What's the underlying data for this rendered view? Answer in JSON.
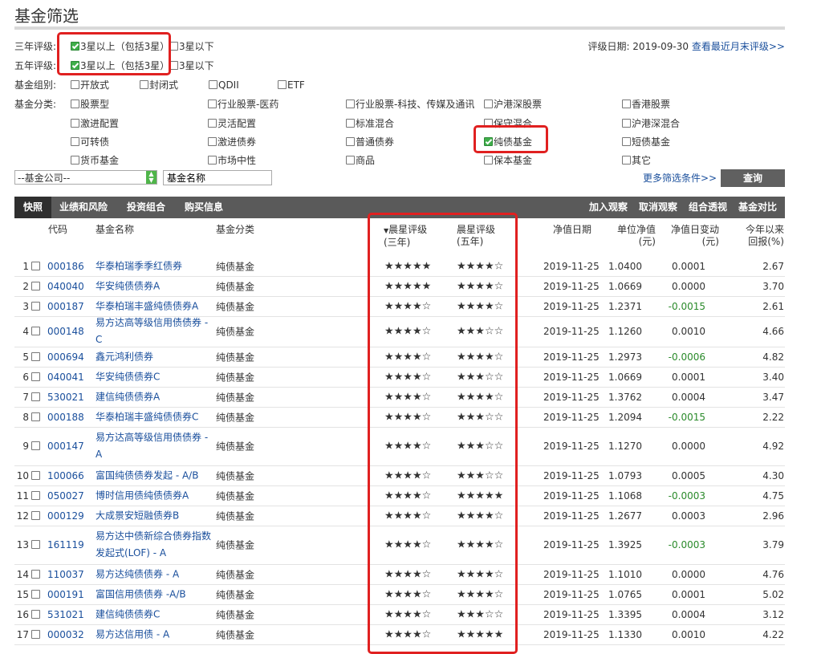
{
  "page_title": "基金筛选",
  "filters": {
    "three_year": {
      "label": "三年评级:",
      "opt1": "3星以上（包括3星）",
      "opt1_checked": true,
      "opt2": "3星以下"
    },
    "five_year": {
      "label": "五年评级:",
      "opt1": "3星以上（包括3星）",
      "opt1_checked": true,
      "opt2": "3星以下"
    },
    "rating_date_label": "评级日期: 2019-09-30",
    "rating_date_link": "查看最近月末评级>>",
    "group": {
      "label": "基金组别:",
      "options": [
        "开放式",
        "封闭式",
        "QDII",
        "ETF"
      ]
    },
    "category": {
      "label": "基金分类:",
      "options": [
        [
          "股票型",
          "行业股票-医药",
          "行业股票-科技、传媒及通讯",
          "沪港深股票",
          "香港股票"
        ],
        [
          "激进配置",
          "灵活配置",
          "标准混合",
          "保守混合",
          "沪港深混合"
        ],
        [
          "可转债",
          "激进债券",
          "普通债券",
          "纯债基金",
          "短债基金"
        ],
        [
          "货币基金",
          "市场中性",
          "商品",
          "保本基金",
          "其它"
        ]
      ],
      "checked": "纯债基金"
    },
    "company_select": "--基金公司--",
    "name_input": "基金名称",
    "more_link": "更多筛选条件>>",
    "search_button": "查询"
  },
  "tabs": [
    "快照",
    "业绩和风险",
    "投资组合",
    "购买信息"
  ],
  "actions": [
    "加入观察",
    "取消观察",
    "组合透视",
    "基金对比"
  ],
  "columns": {
    "code": "代码",
    "name": "基金名称",
    "category": "基金分类",
    "star3": [
      "晨星评级",
      "(三年)"
    ],
    "star5": [
      "晨星评级",
      "(五年)"
    ],
    "date": "净值日期",
    "nav": [
      "单位净值",
      "(元)"
    ],
    "chg": [
      "净值日变动",
      "(元)"
    ],
    "ret": [
      "今年以来",
      "回报(%)"
    ]
  },
  "rows": [
    {
      "idx": "1",
      "code": "000186",
      "name": "华泰柏瑞季季红债券",
      "cat": "纯债基金",
      "s3": 5,
      "s5": 4,
      "date": "2019-11-25",
      "nav": "1.0400",
      "chg": "0.0001",
      "ret": "2.67"
    },
    {
      "idx": "2",
      "code": "040040",
      "name": "华安纯债债券A",
      "cat": "纯债基金",
      "s3": 5,
      "s5": 4,
      "date": "2019-11-25",
      "nav": "1.0669",
      "chg": "0.0000",
      "ret": "3.70"
    },
    {
      "idx": "3",
      "code": "000187",
      "name": "华泰柏瑞丰盛纯债债券A",
      "cat": "纯债基金",
      "s3": 4,
      "s5": 4,
      "date": "2019-11-25",
      "nav": "1.2371",
      "chg": "-0.0015",
      "ret": "2.61"
    },
    {
      "idx": "4",
      "code": "000148",
      "name": "易方达高等级信用债债券 - C",
      "cat": "纯债基金",
      "s3": 4,
      "s5": 3,
      "date": "2019-11-25",
      "nav": "1.1260",
      "chg": "0.0010",
      "ret": "4.66"
    },
    {
      "idx": "5",
      "code": "000694",
      "name": "鑫元鸿利债券",
      "cat": "纯债基金",
      "s3": 4,
      "s5": 4,
      "date": "2019-11-25",
      "nav": "1.2973",
      "chg": "-0.0006",
      "ret": "4.82"
    },
    {
      "idx": "6",
      "code": "040041",
      "name": "华安纯债债券C",
      "cat": "纯债基金",
      "s3": 4,
      "s5": 3,
      "date": "2019-11-25",
      "nav": "1.0669",
      "chg": "0.0001",
      "ret": "3.40"
    },
    {
      "idx": "7",
      "code": "530021",
      "name": "建信纯债债券A",
      "cat": "纯债基金",
      "s3": 4,
      "s5": 4,
      "date": "2019-11-25",
      "nav": "1.3762",
      "chg": "0.0004",
      "ret": "3.47"
    },
    {
      "idx": "8",
      "code": "000188",
      "name": "华泰柏瑞丰盛纯债债券C",
      "cat": "纯债基金",
      "s3": 4,
      "s5": 3,
      "date": "2019-11-25",
      "nav": "1.2094",
      "chg": "-0.0015",
      "ret": "2.22"
    },
    {
      "idx": "9",
      "code": "000147",
      "name": "易方达高等级信用债债券 - A",
      "cat": "纯债基金",
      "s3": 4,
      "s5": 3,
      "date": "2019-11-25",
      "nav": "1.1270",
      "chg": "0.0000",
      "ret": "4.92"
    },
    {
      "idx": "10",
      "code": "100066",
      "name": "富国纯债债券发起 - A/B",
      "cat": "纯债基金",
      "s3": 4,
      "s5": 3,
      "date": "2019-11-25",
      "nav": "1.0793",
      "chg": "0.0005",
      "ret": "4.30"
    },
    {
      "idx": "11",
      "code": "050027",
      "name": "博时信用债纯债债券A",
      "cat": "纯债基金",
      "s3": 4,
      "s5": 5,
      "date": "2019-11-25",
      "nav": "1.1068",
      "chg": "-0.0003",
      "ret": "4.75"
    },
    {
      "idx": "12",
      "code": "000129",
      "name": "大成景安短融债券B",
      "cat": "纯债基金",
      "s3": 4,
      "s5": 4,
      "date": "2019-11-25",
      "nav": "1.2677",
      "chg": "0.0003",
      "ret": "2.96"
    },
    {
      "idx": "13",
      "code": "161119",
      "name": "易方达中债新综合债券指数发起式(LOF) - A",
      "cat": "纯债基金",
      "s3": 4,
      "s5": 4,
      "date": "2019-11-25",
      "nav": "1.3925",
      "chg": "-0.0003",
      "ret": "3.79"
    },
    {
      "idx": "14",
      "code": "110037",
      "name": "易方达纯债债券 - A",
      "cat": "纯债基金",
      "s3": 4,
      "s5": 4,
      "date": "2019-11-25",
      "nav": "1.1010",
      "chg": "0.0000",
      "ret": "4.76"
    },
    {
      "idx": "15",
      "code": "000191",
      "name": "富国信用债债券 -A/B",
      "cat": "纯债基金",
      "s3": 4,
      "s5": 4,
      "date": "2019-11-25",
      "nav": "1.0765",
      "chg": "0.0001",
      "ret": "5.02"
    },
    {
      "idx": "16",
      "code": "531021",
      "name": "建信纯债债券C",
      "cat": "纯债基金",
      "s3": 4,
      "s5": 3,
      "date": "2019-11-25",
      "nav": "1.3395",
      "chg": "0.0004",
      "ret": "3.12"
    },
    {
      "idx": "17",
      "code": "000032",
      "name": "易方达信用债 - A",
      "cat": "纯债基金",
      "s3": 4,
      "s5": 5,
      "date": "2019-11-25",
      "nav": "1.1330",
      "chg": "0.0010",
      "ret": "4.22"
    }
  ]
}
